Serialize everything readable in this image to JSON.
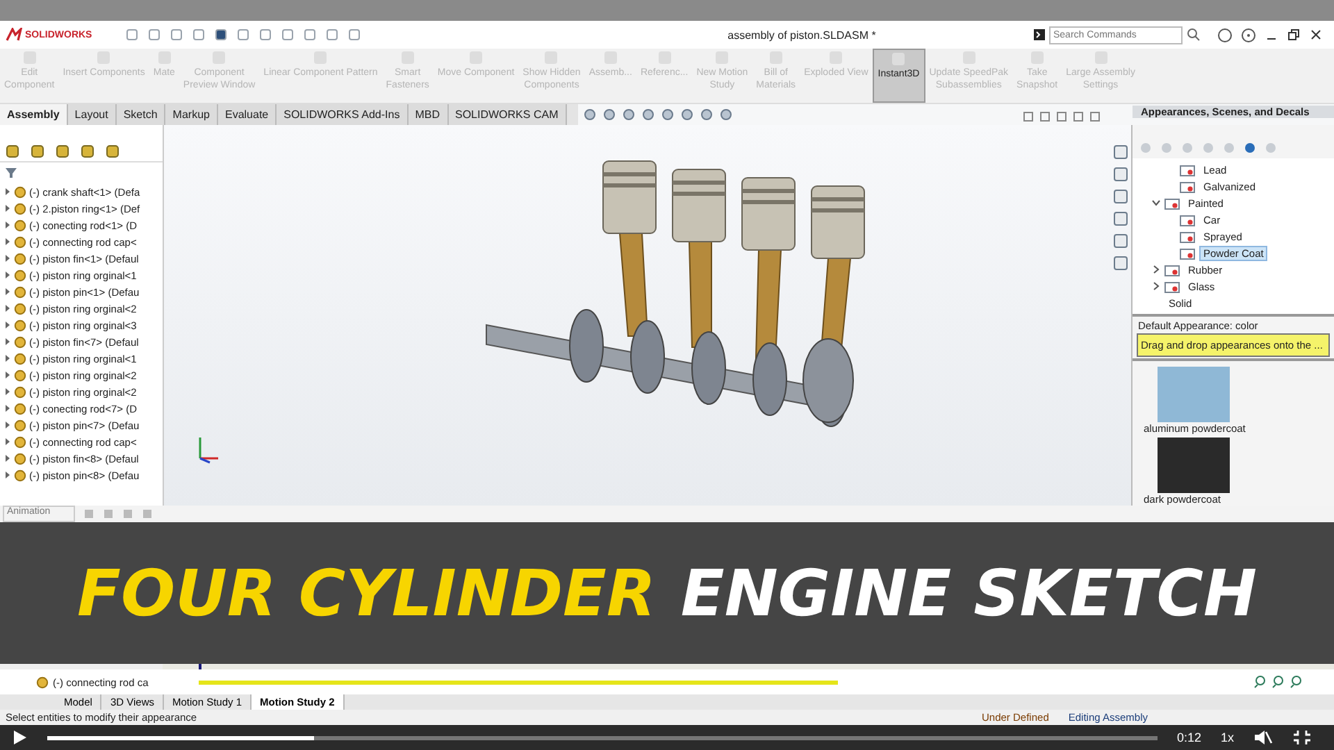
{
  "window": {
    "app_name": "SOLIDWORKS",
    "title": "assembly of piston.SLDASM *",
    "search": {
      "placeholder": "Search Commands"
    }
  },
  "command_manager": [
    {
      "lines": [
        "Edit",
        "Component"
      ],
      "disabled": true,
      "selected": false
    },
    {
      "lines": [
        "Insert Components"
      ],
      "disabled": true,
      "selected": false
    },
    {
      "lines": [
        "Mate"
      ],
      "disabled": true,
      "selected": false
    },
    {
      "lines": [
        "Component",
        "Preview Window"
      ],
      "disabled": true,
      "selected": false
    },
    {
      "lines": [
        "Linear Component Pattern"
      ],
      "disabled": true,
      "selected": false
    },
    {
      "lines": [
        "Smart",
        "Fasteners"
      ],
      "disabled": true,
      "selected": false
    },
    {
      "lines": [
        "Move Component"
      ],
      "disabled": true,
      "selected": false
    },
    {
      "lines": [
        "Show Hidden",
        "Components"
      ],
      "disabled": true,
      "selected": false
    },
    {
      "lines": [
        "Assemb..."
      ],
      "disabled": true,
      "selected": false
    },
    {
      "lines": [
        "Referenc..."
      ],
      "disabled": true,
      "selected": false
    },
    {
      "lines": [
        "New Motion",
        "Study"
      ],
      "disabled": true,
      "selected": false
    },
    {
      "lines": [
        "Bill of",
        "Materials"
      ],
      "disabled": true,
      "selected": false
    },
    {
      "lines": [
        "Exploded View"
      ],
      "disabled": true,
      "selected": false
    },
    {
      "lines": [
        "Instant3D"
      ],
      "disabled": false,
      "selected": true
    },
    {
      "lines": [
        "Update SpeedPak",
        "Subassemblies"
      ],
      "disabled": true,
      "selected": false
    },
    {
      "lines": [
        "Take",
        "Snapshot"
      ],
      "disabled": true,
      "selected": false
    },
    {
      "lines": [
        "Large Assembly",
        "Settings"
      ],
      "disabled": true,
      "selected": false
    }
  ],
  "tabs": [
    {
      "label": "Assembly",
      "selected": true
    },
    {
      "label": "Layout",
      "selected": false
    },
    {
      "label": "Sketch",
      "selected": false
    },
    {
      "label": "Markup",
      "selected": false
    },
    {
      "label": "Evaluate",
      "selected": false
    },
    {
      "label": "SOLIDWORKS Add-Ins",
      "selected": false
    },
    {
      "label": "MBD",
      "selected": false
    },
    {
      "label": "SOLIDWORKS CAM",
      "selected": false
    }
  ],
  "feature_tree": [
    "(-) crank shaft<1> (Defa",
    "(-) 2.piston ring<1> (Def",
    "(-) conecting rod<1> (D",
    "(-) connecting rod cap<",
    "(-) piston fin<1> (Defaul",
    "(-) piston ring orginal<1",
    "(-) piston pin<1> (Defau",
    "(-) piston ring orginal<2",
    "(-) piston ring orginal<3",
    "(-) piston fin<7> (Defaul",
    "(-) piston ring orginal<1",
    "(-) piston ring orginal<2",
    "(-) piston ring orginal<2",
    "(-) conecting rod<7> (D",
    "(-) piston pin<7> (Defau",
    "(-) connecting rod cap<",
    "(-) piston fin<8> (Defaul",
    "(-) piston pin<8> (Defau"
  ],
  "appearances": {
    "title": "Appearances, Scenes, and Decals",
    "tree_above": [
      {
        "label": "Lead",
        "selected": false
      },
      {
        "label": "Galvanized",
        "selected": false
      }
    ],
    "tree": [
      {
        "label": "Painted",
        "expanded": true,
        "children": [
          {
            "label": "Car",
            "selected": false
          },
          {
            "label": "Sprayed",
            "selected": false
          },
          {
            "label": "Powder Coat",
            "selected": true
          }
        ]
      },
      {
        "label": "Rubber",
        "expanded": false
      },
      {
        "label": "Glass",
        "expanded": false
      }
    ],
    "tree_cut": "Solid",
    "default_label": "Default Appearance: color",
    "hint": "Drag and drop appearances onto the ...",
    "swatches": [
      {
        "label": "aluminum powdercoat",
        "color": "#8fb8d6"
      },
      {
        "label": "dark powdercoat",
        "color": "#2a2a2a"
      }
    ]
  },
  "motion_study": {
    "type": "Animation",
    "visible_row": "(-) connecting rod ca"
  },
  "banner": {
    "highlight": "FOUR CYLINDER",
    "rest": "ENGINE SKETCH"
  },
  "bottom_tabs": [
    {
      "label": "Model",
      "selected": false
    },
    {
      "label": "3D Views",
      "selected": false
    },
    {
      "label": "Motion Study 1",
      "selected": false
    },
    {
      "label": "Motion Study 2",
      "selected": true
    }
  ],
  "status_bar": {
    "message": "Select entities to modify their appearance",
    "state": "Under Defined",
    "mode": "Editing Assembly"
  },
  "player": {
    "level": 0.24,
    "time": "0:12",
    "speed": "1x"
  }
}
